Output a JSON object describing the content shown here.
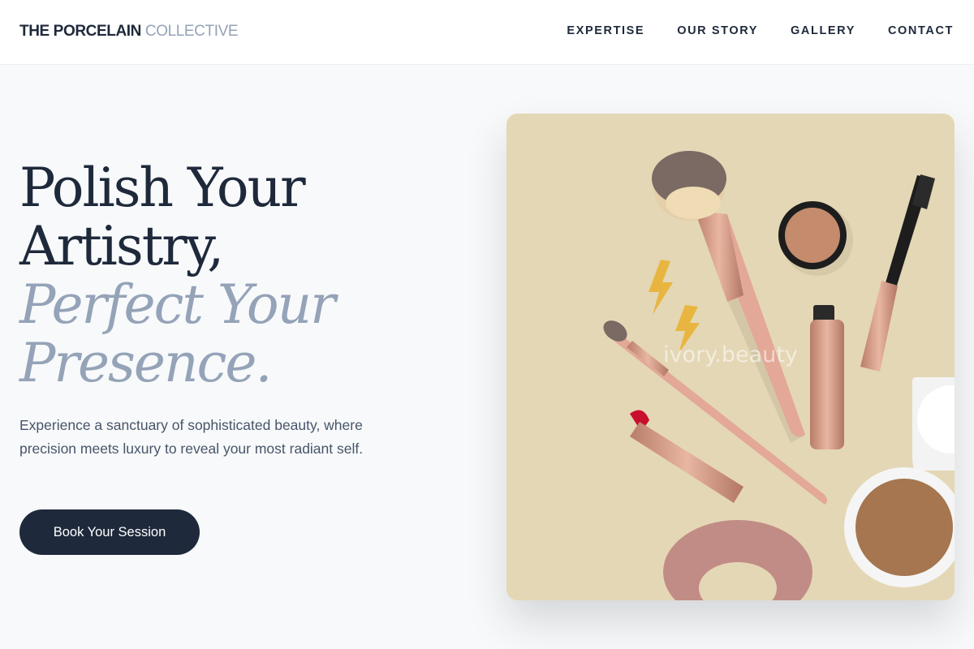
{
  "brand": {
    "name_strong": "THE PORCELAIN",
    "name_light": "COLLECTIVE"
  },
  "nav": {
    "items": [
      {
        "label": "EXPERTISE"
      },
      {
        "label": "OUR STORY"
      },
      {
        "label": "GALLERY"
      },
      {
        "label": "CONTACT"
      }
    ]
  },
  "hero": {
    "headline_line1": "Polish Your",
    "headline_line2": "Artistry,",
    "headline_line3": "Perfect Your",
    "headline_line4": "Presence.",
    "description": "Experience a sanctuary of sophisticated beauty, where precision meets luxury to reveal your most radiant self.",
    "cta_label": "Book Your Session"
  },
  "image": {
    "watermark": "ivory.beauty"
  },
  "colors": {
    "navy": "#1e293b",
    "slate_muted": "#94a3b8",
    "background": "#f8f9fa",
    "photo_backdrop": "#e4d7b5",
    "rose_gold": "#d9a28c"
  }
}
